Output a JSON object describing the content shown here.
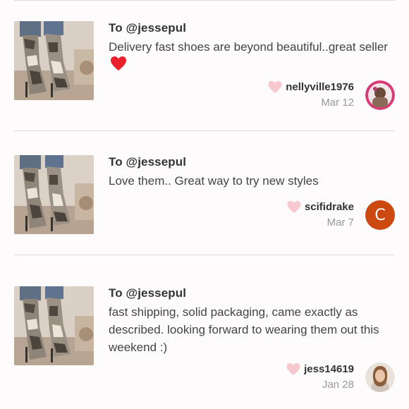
{
  "reviews": [
    {
      "to_line": "To @jessepul",
      "text": "Delivery fast shoes are beyond beautiful..great seller",
      "has_heart_emoji": true,
      "username": "nellyville1976",
      "date": "Mar 12",
      "avatar_type": "photo",
      "like_icon": "heart-outline-icon"
    },
    {
      "to_line": "To @jessepul",
      "text": "Love them.. Great way to try new styles",
      "has_heart_emoji": false,
      "username": "scifidrake",
      "date": "Mar 7",
      "avatar_type": "letter",
      "avatar_letter": "C",
      "avatar_color": "#cc4a12",
      "like_icon": "heart-outline-icon"
    },
    {
      "to_line": "To @jessepul",
      "text": "fast shipping, solid packaging, came exactly as described. looking forward to wearing them out this weekend :)",
      "has_heart_emoji": false,
      "username": "jess14619",
      "date": "Jan 28",
      "avatar_type": "photo",
      "like_icon": "heart-outline-icon"
    }
  ],
  "colors": {
    "like_heart": "#f7c8ce",
    "emoji_heart": "#e8202c",
    "divider": "#dcdcdc",
    "date": "#9a9a9a"
  }
}
